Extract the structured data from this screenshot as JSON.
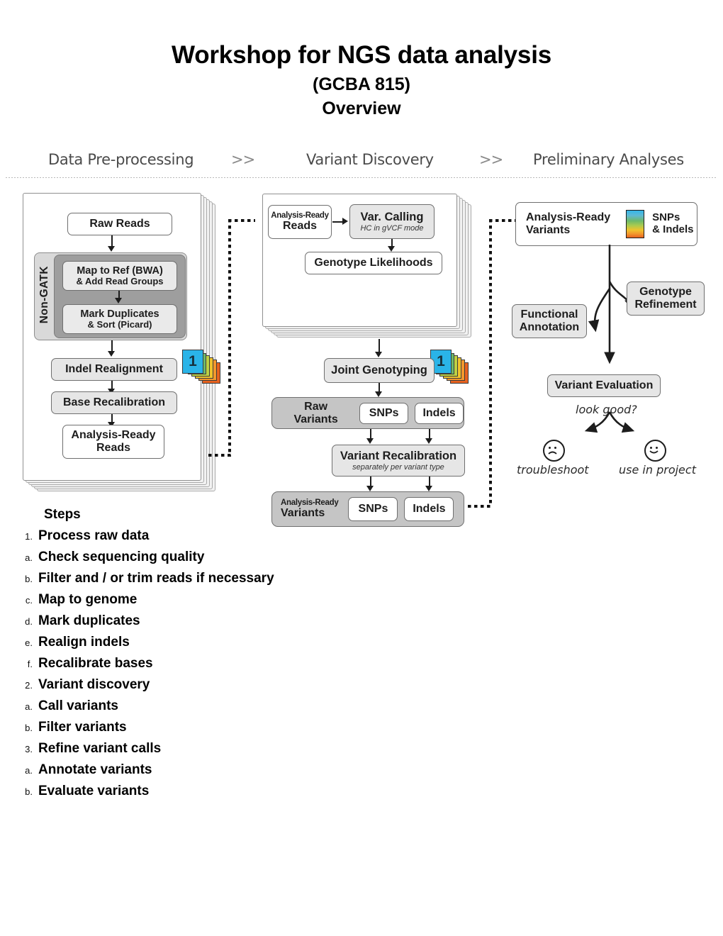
{
  "title": {
    "main": "Workshop for NGS data analysis",
    "course": "(GCBA 815)",
    "section": "Overview"
  },
  "diagram": {
    "phases": [
      {
        "label": "Data Pre-processing"
      },
      {
        "label": "Variant Discovery"
      },
      {
        "label": "Preliminary Analyses"
      }
    ],
    "phase_separator": ">>",
    "preprocessing": {
      "sample_badge": "1",
      "raw_reads": "Raw Reads",
      "non_gatk_label": "Non-GATK",
      "map_to_ref": "Map to Ref (BWA)",
      "map_to_ref_sub": "& Add Read Groups",
      "mark_dup": "Mark Duplicates",
      "mark_dup_sub": "& Sort (Picard)",
      "indel_realignment": "Indel Realignment",
      "base_recalibration": "Base Recalibration",
      "analysis_ready_1": "Analysis-Ready",
      "analysis_ready_2": "Reads"
    },
    "discovery": {
      "sample_badge": "1",
      "ar_reads_1": "Analysis-Ready",
      "ar_reads_2": "Reads",
      "var_calling": "Var. Calling",
      "var_calling_sub": "HC in gVCF mode",
      "genotype_likelihoods": "Genotype Likelihoods",
      "joint_genotyping": "Joint Genotyping",
      "raw_variants": "Raw Variants",
      "raw_snps": "SNPs",
      "raw_indels": "Indels",
      "variant_recal": "Variant Recalibration",
      "variant_recal_sub": "separately per variant type",
      "ar_variants_1": "Analysis-Ready",
      "ar_variants_2": "Variants",
      "ar_snps": "SNPs",
      "ar_indels": "Indels"
    },
    "analyses": {
      "ar_variants_1": "Analysis-Ready",
      "ar_variants_2": "Variants",
      "swatch_label_1": "SNPs",
      "swatch_label_2": "& Indels",
      "genotype_refinement_1": "Genotype",
      "genotype_refinement_2": "Refinement",
      "functional_annotation_1": "Functional",
      "functional_annotation_2": "Annotation",
      "variant_evaluation": "Variant Evaluation",
      "look_good": "look good?",
      "troubleshoot": "troubleshoot",
      "use_in_project": "use in project"
    },
    "colors": {
      "tab_cyan": "#2ab4e8",
      "tab_green": "#6db96a",
      "tab_yellowgreen": "#bdd144",
      "tab_yellow": "#f0c32d",
      "tab_lightorange": "#f2982d",
      "tab_orange": "#e8621f",
      "panel_gray": "#9e9e9e",
      "panel_light": "#d9d9d9",
      "box_light": "#e6e6e6",
      "box_mid": "#c5c5c5"
    }
  },
  "steps": {
    "heading": "Steps",
    "items": [
      {
        "marker": "1.",
        "text": "Process raw data"
      },
      {
        "marker": "a.",
        "text": "Check sequencing quality"
      },
      {
        "marker": "b.",
        "text": "Filter and / or trim reads if necessary"
      },
      {
        "marker": "c.",
        "text": "Map to genome"
      },
      {
        "marker": "d.",
        "text": "Mark duplicates"
      },
      {
        "marker": "e.",
        "text": "Realign indels"
      },
      {
        "marker": "f.",
        "text": "Recalibrate bases"
      },
      {
        "marker": "2.",
        "text": "Variant discovery"
      },
      {
        "marker": "a.",
        "text": "Call variants"
      },
      {
        "marker": "b.",
        "text": "Filter variants"
      },
      {
        "marker": "3.",
        "text": "Refine variant calls"
      },
      {
        "marker": "a.",
        "text": "Annotate variants"
      },
      {
        "marker": "b.",
        "text": "Evaluate variants"
      }
    ]
  }
}
